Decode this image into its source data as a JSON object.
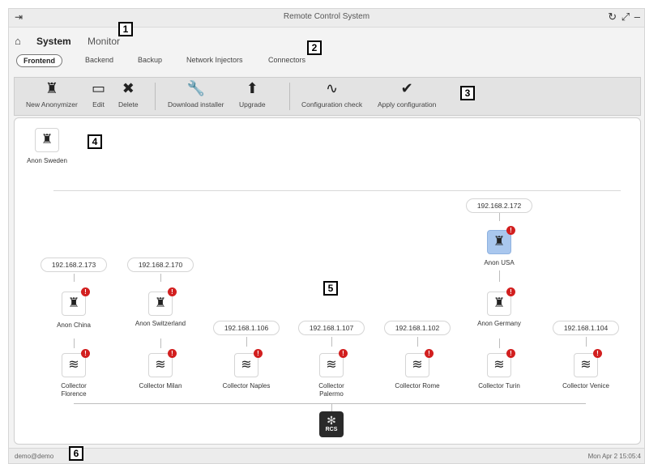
{
  "window": {
    "title": "Remote Control System"
  },
  "nav": {
    "system": "System",
    "monitor": "Monitor"
  },
  "tabs": [
    "Frontend",
    "Backend",
    "Backup",
    "Network Injectors",
    "Connectors"
  ],
  "toolbar": {
    "new_anonymizer": "New Anonymizer",
    "edit": "Edit",
    "delete": "Delete",
    "download_installer": "Download installer",
    "upgrade": "Upgrade",
    "config_check": "Configuration check",
    "apply_config": "Apply configuration"
  },
  "unassigned": [
    {
      "label": "Anon Sweden"
    }
  ],
  "ips": {
    "usa": "192.168.2.172",
    "china": "192.168.2.173",
    "switzerland": "192.168.2.170",
    "naples": "192.168.1.106",
    "palermo": "192.168.1.107",
    "rome": "192.168.1.102",
    "venice": "192.168.1.104"
  },
  "anons": {
    "usa": "Anon USA",
    "china": "Anon China",
    "switzerland": "Anon Switzerland",
    "germany": "Anon Germany"
  },
  "collectors": {
    "florence": "Collector Florence",
    "milan": "Collector Milan",
    "naples": "Collector Naples",
    "palermo": "Collector Palermo",
    "rome": "Collector Rome",
    "turin": "Collector Turin",
    "venice": "Collector Venice"
  },
  "rcs_label": "RCS",
  "status": {
    "user": "demo@demo",
    "time": "Mon Apr 2 15:05:4"
  },
  "callouts": [
    "1",
    "2",
    "3",
    "4",
    "5",
    "6"
  ],
  "badge_symbol": "!",
  "icons": {
    "anonymizer": "anonymizer-icon",
    "collector": "wifi-icon",
    "rcs": "rcs-logo-icon"
  }
}
